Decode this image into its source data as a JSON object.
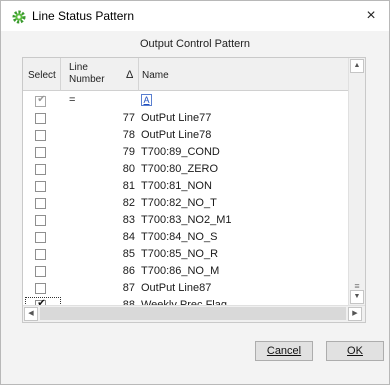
{
  "window": {
    "title": "Line Status Pattern",
    "close_glyph": "×"
  },
  "section_title": "Output Control Pattern",
  "table": {
    "headers": {
      "select": "Select",
      "line_number_1": "Line",
      "line_number_2": "Number",
      "sort_glyph": "Δ",
      "name": "Name"
    },
    "filter_row": {
      "number": "=",
      "name_icon": "A"
    },
    "rows": [
      {
        "number": "77",
        "name": "OutPut Line77",
        "checked": false
      },
      {
        "number": "78",
        "name": "OutPut Line78",
        "checked": false
      },
      {
        "number": "79",
        "name": "T700:89_COND",
        "checked": false
      },
      {
        "number": "80",
        "name": "T700:80_ZERO",
        "checked": false
      },
      {
        "number": "81",
        "name": "T700:81_NON",
        "checked": false
      },
      {
        "number": "82",
        "name": "T700:82_NO_T",
        "checked": false
      },
      {
        "number": "83",
        "name": "T700:83_NO2_M1",
        "checked": false
      },
      {
        "number": "84",
        "name": "T700:84_NO_S",
        "checked": false
      },
      {
        "number": "85",
        "name": "T700:85_NO_R",
        "checked": false
      },
      {
        "number": "86",
        "name": "T700:86_NO_M",
        "checked": false
      },
      {
        "number": "87",
        "name": "OutPut Line87",
        "checked": false
      },
      {
        "number": "88",
        "name": "Weekly Prec Flag",
        "checked": true
      }
    ]
  },
  "buttons": {
    "cancel": "Cancel",
    "ok": "OK"
  }
}
